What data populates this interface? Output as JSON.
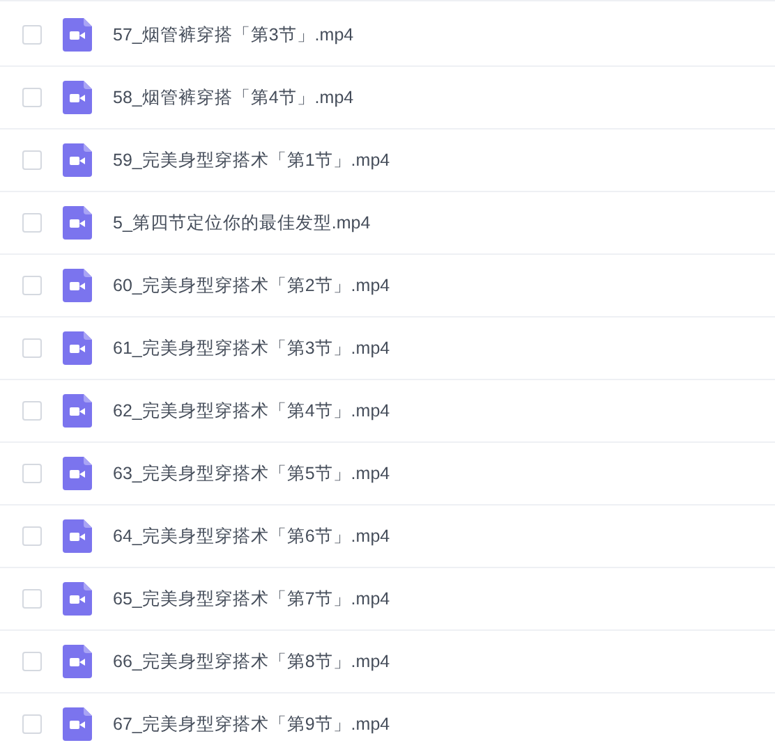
{
  "files": [
    {
      "name": "57_烟管裤穿搭「第3节」.mp4",
      "checked": false
    },
    {
      "name": "58_烟管裤穿搭「第4节」.mp4",
      "checked": false
    },
    {
      "name": "59_完美身型穿搭术「第1节」.mp4",
      "checked": false
    },
    {
      "name": "5_第四节定位你的最佳发型.mp4",
      "checked": false
    },
    {
      "name": "60_完美身型穿搭术「第2节」.mp4",
      "checked": false
    },
    {
      "name": "61_完美身型穿搭术「第3节」.mp4",
      "checked": false
    },
    {
      "name": "62_完美身型穿搭术「第4节」.mp4",
      "checked": false
    },
    {
      "name": "63_完美身型穿搭术「第5节」.mp4",
      "checked": false
    },
    {
      "name": "64_完美身型穿搭术「第6节」.mp4",
      "checked": false
    },
    {
      "name": "65_完美身型穿搭术「第7节」.mp4",
      "checked": false
    },
    {
      "name": "66_完美身型穿搭术「第8节」.mp4",
      "checked": false
    },
    {
      "name": "67_完美身型穿搭术「第9节」.mp4",
      "checked": false
    }
  ]
}
